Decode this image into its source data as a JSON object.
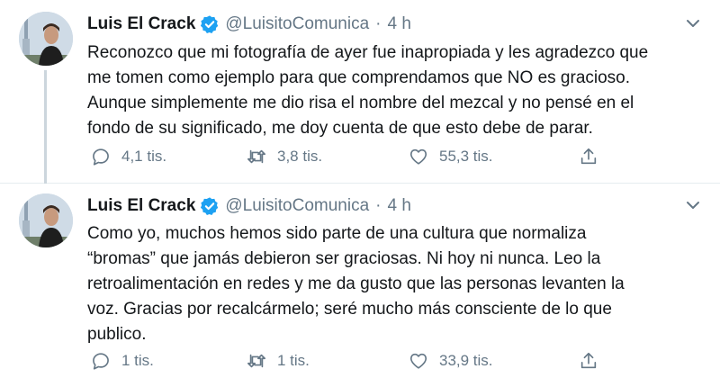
{
  "tweets": [
    {
      "name": "Luis El Crack",
      "handle": "@LuisitoComunica",
      "separator": "·",
      "time": "4 h",
      "text": "Reconozco que mi fotografía de ayer fue inapropiada y les agradezco que\nme tomen como ejemplo para que comprendamos que NO es gracioso.\nAunque simplemente me dio risa el nombre del mezcal y no pensé en el\nfondo de su significado, me doy cuenta de que esto debe de parar.",
      "replies": "4,1 tis.",
      "retweets": "3,8 tis.",
      "likes": "55,3 tis."
    },
    {
      "name": "Luis El Crack",
      "handle": "@LuisitoComunica",
      "separator": "·",
      "time": "4 h",
      "text": "Como yo, muchos hemos sido parte de una cultura que normaliza\n“bromas” que jamás debieron ser graciosas. Ni hoy ni nunca. Leo la\nretroalimentación en redes y me da gusto que las personas levanten la\nvoz. Gracias por recalcármelo; seré mucho más consciente de lo que\npublico.",
      "replies": "1 tis.",
      "retweets": "1 tis.",
      "likes": "33,9 tis."
    }
  ],
  "colors": {
    "text": "#14171a",
    "muted": "#657786",
    "verified": "#1da1f2",
    "thread_line": "#ccd6dd"
  }
}
